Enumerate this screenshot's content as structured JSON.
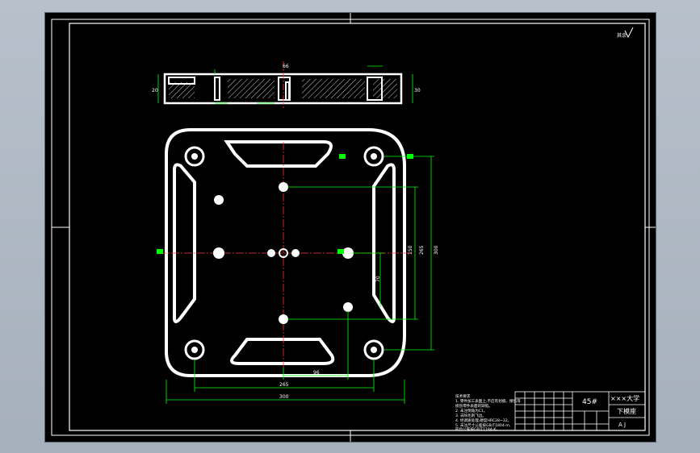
{
  "drawing": {
    "roughness_mark": "其余",
    "tech_requirements": [
      "技术要求",
      "1. 零件加工表面上,不应有划痕、擦伤等",
      "   损伤零件表面的缺陷。",
      "2. 未注倒角为C1。",
      "3. 去除毛刺飞边。",
      "4. 经调质处理,硬度HRC28~32。",
      "5. 未注尺寸公差按GB/T1804-m,",
      "   形位公差按GB/T1184-K。"
    ],
    "dimensions": {
      "bottom_inner": "96",
      "bottom_mid": "265",
      "bottom_overall": "300",
      "right_1": "150",
      "right_2": "265",
      "right_3": "300",
      "right_small": "70",
      "side_top": "66",
      "side_left": "20",
      "side_right": "30"
    }
  },
  "title_block": {
    "material": "45#",
    "school": "×××大学",
    "part_name": "下模座",
    "sheet": "A J"
  }
}
